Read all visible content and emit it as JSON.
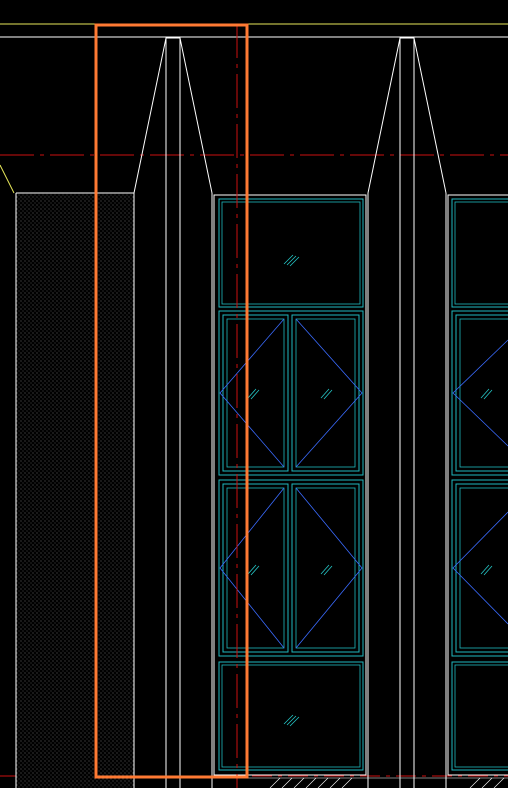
{
  "view": {
    "background": "#000000",
    "colors": {
      "line_white": "#ffffff",
      "line_yellow": "#e8e85a",
      "centerline_red": "#cc1111",
      "window_cyan": "#1fb9bf",
      "opening_blue": "#3a6bff",
      "glass_hatch_cyan": "#25c7c7",
      "selection_orange": "#ff7a33",
      "fill_dots": "#7a7a7a"
    }
  }
}
